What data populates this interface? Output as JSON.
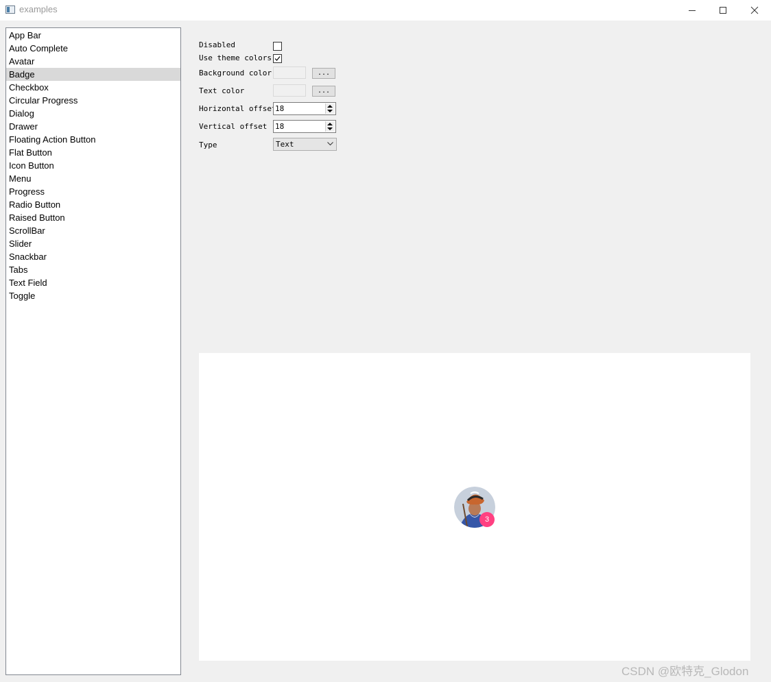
{
  "window": {
    "title": "examples",
    "icon": "app-window-icon",
    "controls": [
      "minimize-icon",
      "maximize-icon",
      "close-icon"
    ]
  },
  "sidebar": {
    "selected": "Badge",
    "items": [
      {
        "label": "App Bar"
      },
      {
        "label": "Auto Complete"
      },
      {
        "label": "Avatar"
      },
      {
        "label": "Badge"
      },
      {
        "label": "Checkbox"
      },
      {
        "label": "Circular Progress"
      },
      {
        "label": "Dialog"
      },
      {
        "label": "Drawer"
      },
      {
        "label": "Floating Action Button"
      },
      {
        "label": "Flat Button"
      },
      {
        "label": "Icon Button"
      },
      {
        "label": "Menu"
      },
      {
        "label": "Progress"
      },
      {
        "label": "Radio Button"
      },
      {
        "label": "Raised Button"
      },
      {
        "label": "ScrollBar"
      },
      {
        "label": "Slider"
      },
      {
        "label": "Snackbar"
      },
      {
        "label": "Tabs"
      },
      {
        "label": "Text Field"
      },
      {
        "label": "Toggle"
      }
    ]
  },
  "settings": {
    "disabled_label": "Disabled",
    "disabled_checked": false,
    "use_theme_colors_label": "Use theme colors",
    "use_theme_colors_checked": true,
    "background_color_label": "Background color",
    "background_color_button": "...",
    "text_color_label": "Text color",
    "text_color_button": "...",
    "horizontal_offset_label": "Horizontal offset",
    "horizontal_offset_value": "18",
    "vertical_offset_label": "Vertical offset",
    "vertical_offset_value": "18",
    "type_label": "Type",
    "type_value": "Text"
  },
  "preview": {
    "avatar_icon": "avatar-photo-icon",
    "badge_text": "3",
    "badge_color": "#ff4081"
  },
  "watermark": "CSDN @欧特克_Glodon"
}
